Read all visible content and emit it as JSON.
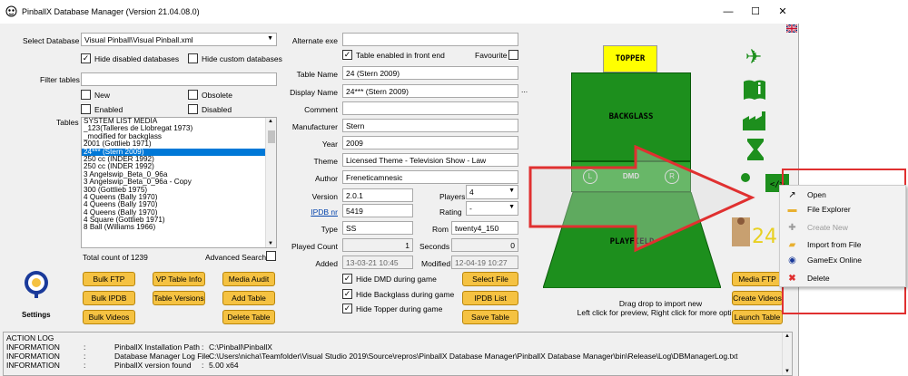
{
  "window": {
    "title": "PinballX Database Manager (Version 21.04.08.0)",
    "min": "—",
    "max": "☐",
    "close": "✕",
    "flag": "🇬🇧"
  },
  "left": {
    "select_db_label": "Select Database",
    "select_db_value": "Visual Pinball\\Visual Pinball.xml",
    "hide_disabled": "Hide disabled databases",
    "hide_custom": "Hide custom databases",
    "filter_label": "Filter tables",
    "filter_value": "",
    "new": "New",
    "obsolete": "Obsolete",
    "enabled": "Enabled",
    "disabled": "Disabled",
    "tables_label": "Tables",
    "tables": [
      "SYSTEM LIST MEDIA",
      "_123(Talleres de Llobregat 1973)",
      "_modified for backglass",
      "2001 (Gottlieb 1971)",
      "24*** (Stern 2009)",
      "250 cc (INDER 1992)",
      "250 cc (INDER 1992)",
      "3 Angelswip_Beta_0_96a",
      "3 Angelswip_Beta_0_96a - Copy",
      "300 (Gottlieb 1975)",
      "4 Queens (Bally 1970)",
      "4 Queens (Bally 1970)",
      "4 Queens (Bally 1970)",
      "4 Square (Gottlieb 1971)",
      "8 Ball (Williams 1966)"
    ],
    "selected_index": 4,
    "total_count": "Total count of 1239",
    "advanced_search": "Advanced Search",
    "buttons": {
      "bulk_ftp": "Bulk FTP",
      "vp_table_info": "VP Table Info",
      "media_audit": "Media Audit",
      "bulk_ipdb": "Bulk IPDB",
      "table_versions": "Table Versions",
      "add_table": "Add Table",
      "bulk_videos": "Bulk Videos",
      "delete_table": "Delete Table"
    },
    "settings": "Settings"
  },
  "form": {
    "alternate_exe_label": "Alternate exe",
    "alternate_exe": "",
    "enabled_front_end": "Table enabled in front end",
    "favourite": "Favourite",
    "table_name_label": "Table Name",
    "table_name": "24 (Stern 2009)",
    "display_name_label": "Display Name",
    "display_name": "24*** (Stern 2009)",
    "ellipsis": "...",
    "comment_label": "Comment",
    "comment": "",
    "manufacturer_label": "Manufacturer",
    "manufacturer": "Stern",
    "year_label": "Year",
    "year": "2009",
    "theme_label": "Theme",
    "theme": "Licensed Theme - Television Show - Law",
    "author_label": "Author",
    "author": "Freneticamnesic",
    "version_label": "Version",
    "version": "2.0.1",
    "players_label": "Players",
    "players": "4",
    "ipdb_label": "IPDB nr",
    "ipdb": "5419",
    "rating_label": "Rating",
    "rating": "-",
    "type_label": "Type",
    "type": "SS",
    "rom_label": "Rom",
    "rom": "twenty4_150",
    "played_count_label": "Played Count",
    "played_count": "1",
    "seconds_label": "Seconds",
    "seconds": "0",
    "added_label": "Added",
    "added": "13-03-21 10:45",
    "modified_label": "Modified",
    "modified": "12-04-19 10:27",
    "hide_dmd": "Hide DMD during game",
    "hide_backglass": "Hide Backglass during game",
    "hide_topper": "Hide Topper during game",
    "select_file": "Select File",
    "ipdb_list": "IPDB List",
    "save_table": "Save Table"
  },
  "preview": {
    "topper": "TOPPER",
    "backglass": "BACKGLASS",
    "dmd": "DMD",
    "playfield": "PLAYFIELD",
    "hint1": "Drag drop to import new",
    "hint2": "Left click for preview, Right click for more options",
    "media_ftp": "Media FTP",
    "create_videos": "Create Videos",
    "launch_table": "Launch Table"
  },
  "log": {
    "title": "ACTION LOG",
    "rows": [
      {
        "level": "INFORMATION",
        "sep": ":",
        "key": "PinballX Installation Path",
        "sep2": ":",
        "value": "C:\\Pinball\\PinballX"
      },
      {
        "level": "INFORMATION",
        "sep": ":",
        "key": "Database Manager Log File",
        "sep2": ":",
        "value": "C:\\Users\\nicha\\Teamfolder\\Visual Studio 2019\\Source\\repros\\PinballX Database Manager\\PinballX Database Manager\\bin\\Release\\Log\\DBManagerLog.txt"
      },
      {
        "level": "INFORMATION",
        "sep": ":",
        "key": "PinballX version found",
        "sep2": ":",
        "value": "5.00 x64"
      }
    ]
  },
  "context_menu": {
    "open": "Open",
    "file_explorer": "File Explorer",
    "create_new": "Create New",
    "import_from_file": "Import from File",
    "gameex_online": "GameEx Online",
    "delete": "Delete"
  },
  "colors": {
    "accent_green": "#1d8f1d",
    "button_yellow": "#f5c242",
    "highlight_red": "#e03030",
    "selection_blue": "#0078d7"
  }
}
